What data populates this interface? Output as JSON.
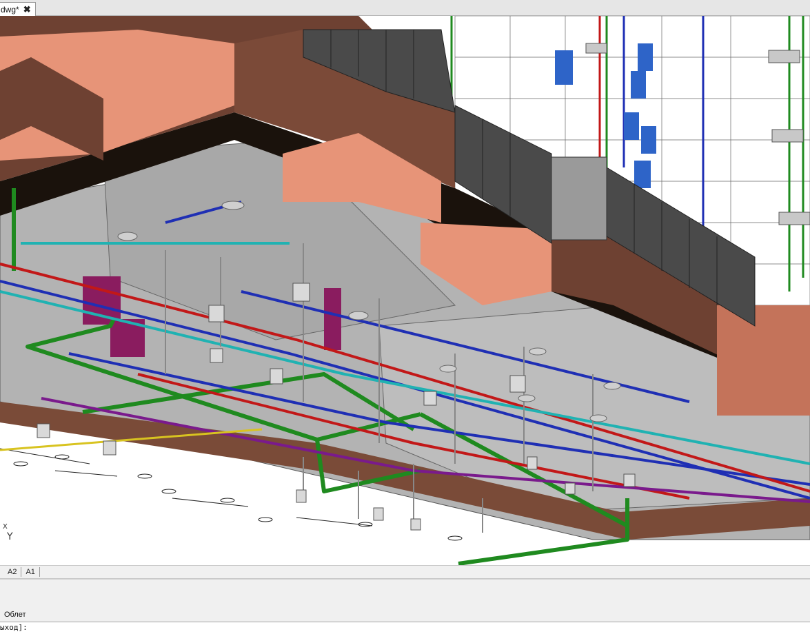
{
  "document_tab": {
    "label": "dwg*",
    "close_glyph": "✖"
  },
  "viewport": {
    "ucs_icon": "ucs-axis-icon",
    "ucs_label": "Y",
    "ucs_tick": "X"
  },
  "layout_tabs": [
    "A2",
    "A1"
  ],
  "command": {
    "history": "Облет",
    "prompt": "ыход]:",
    "input_value": ""
  },
  "colors": {
    "duct_brown": "#6e4132",
    "duct_salmon": "#e79478",
    "slab_gray": "#b3b3b3",
    "pipe_green": "#1f8a1f",
    "pipe_blue": "#1f2fb4",
    "pipe_red": "#c21818",
    "pipe_cyan": "#20b2b2",
    "pipe_purple": "#7a1a8c",
    "radiator_blue": "#2e64c8"
  }
}
